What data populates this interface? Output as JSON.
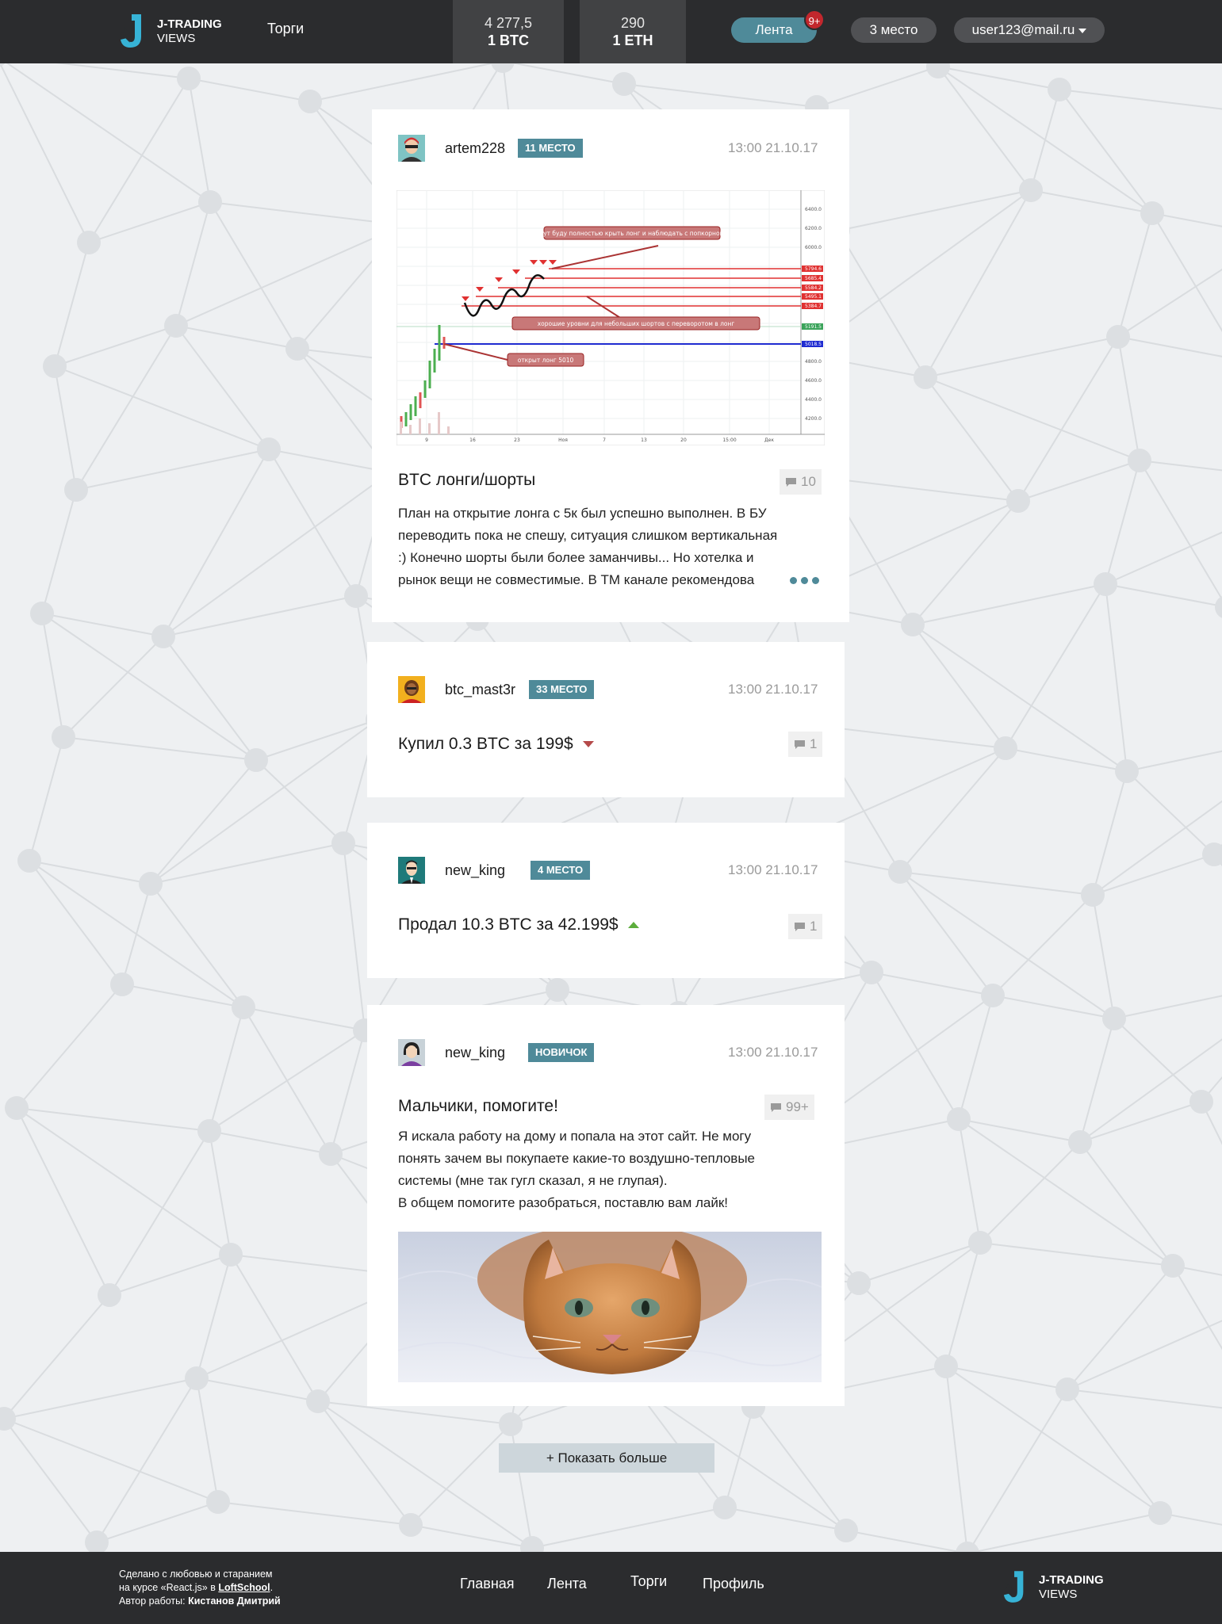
{
  "header": {
    "logo": {
      "line1": "J-TRADING",
      "line2": "VIEWS",
      "icon": "j-logo-icon"
    },
    "nav_trades": "Торги",
    "rates": [
      {
        "value": "4 277,5",
        "currency": "1 BTC"
      },
      {
        "value": "290",
        "currency": "1 ETH"
      }
    ],
    "feed_label": "Лента",
    "notifications": "9+",
    "place_label": "3 место",
    "user_email": "user123@mail.ru"
  },
  "posts": [
    {
      "username": "artem228",
      "rank": "11 МЕСТО",
      "time": "13:00 21.10.17",
      "title": "BTC лонги/шорты",
      "comments": "10",
      "body_lines": [
        "План на открытие лонга с 5к был успешно выполнен. В БУ",
        "переводить пока не спешу, ситуация слишком вертикальная",
        ":) Конечно шорты были более заманчивы... Но хотелка и",
        "рынок вещи не совместимые. В ТМ канале рекомендова"
      ],
      "chart": {
        "annotation_top": "тут буду полностью крыть лонг и наблюдать с попкорном",
        "annotation_mid": "хорошие уровни для небольших шортов с переворотом в лонг",
        "annotation_bottom": "открыт лонг 5010",
        "y_ticks": [
          "6400.0",
          "6200.0",
          "6000.0",
          "5794.6",
          "5685.4",
          "5584.2",
          "5495.1",
          "5384.7",
          "5191.5",
          "5018.5",
          "4800.0",
          "4600.0",
          "4400.0",
          "4200.0"
        ],
        "x_ticks": [
          "9",
          "16",
          "23",
          "Ноя",
          "7",
          "13",
          "20",
          "15:00",
          "Дек"
        ]
      }
    },
    {
      "username": "btc_mast3r",
      "rank": "33 МЕСТО",
      "time": "13:00 21.10.17",
      "title": "Купил 0.3 BTC за 199$",
      "comments": "1",
      "trend": "down"
    },
    {
      "username": "new_king",
      "rank": "4 МЕСТО",
      "time": "13:00 21.10.17",
      "title": "Продал 10.3 BTC за 42.199$",
      "comments": "1",
      "trend": "up"
    },
    {
      "username": "new_king",
      "rank": "НОВИЧОК",
      "time": "13:00 21.10.17",
      "title": "Мальчики, помогите!",
      "comments": "99+",
      "body_lines": [
        "Я искала работу на дому и попала на этот сайт. Не могу",
        "понять зачем вы покупаете какие-то воздушно-тепловые",
        "системы (мне так гугл сказал, я не глупая).",
        "В общем помогите разобраться, поставлю вам лайк!"
      ]
    }
  ],
  "show_more": "+ Показать больше",
  "footer": {
    "credits_line1": "Сделано с любовью и старанием",
    "credits_line2_pre": "на курсе «React.js» в ",
    "credits_school": "LoftSchool",
    "credits_line2_post": ".",
    "credits_line3_pre": "Автор работы: ",
    "credits_author": "Кистанов Дмитрий",
    "nav": [
      "Главная",
      "Лента",
      "Торги",
      "Профиль"
    ],
    "logo": {
      "line1": "J-TRADING",
      "line2": "VIEWS"
    }
  },
  "colors": {
    "header_bg": "#2b2c2e",
    "accent": "#4f8a99",
    "badge_red": "#c2272d",
    "page_bg": "#eef0f2",
    "trend_down": "#b54a4a",
    "trend_up": "#5cad3c"
  }
}
